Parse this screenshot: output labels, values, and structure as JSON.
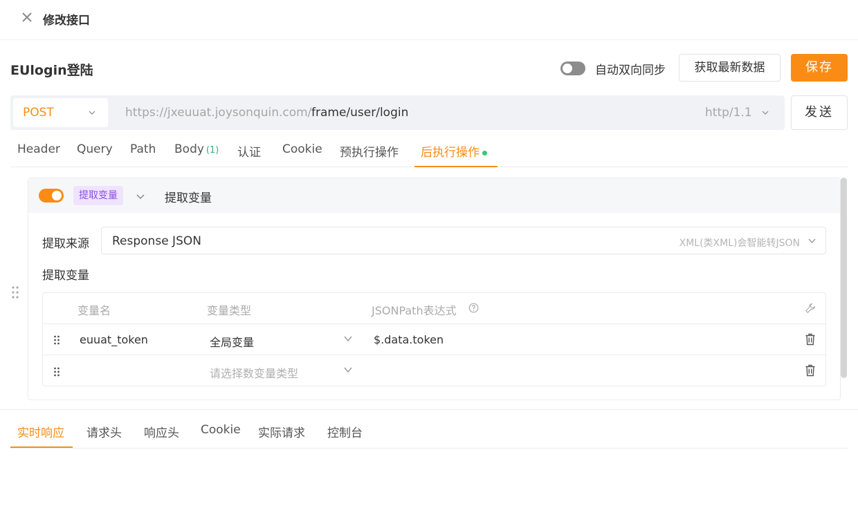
{
  "dialog": {
    "title": "修改接口"
  },
  "header": {
    "api_name": "EUlogin登陆",
    "sync_label": "自动双向同步",
    "fetch_label": "获取最新数据",
    "save_label": "保存"
  },
  "request": {
    "method": "POST",
    "base_url": "https://jxeuuat.joysonquin.com/",
    "path": "frame/user/login",
    "http_version": "http/1.1",
    "send_label": "发送"
  },
  "request_tabs": {
    "header": "Header",
    "query": "Query",
    "path": "Path",
    "body": "Body",
    "body_count": "(1)",
    "auth": "认证",
    "cookie": "Cookie",
    "pre_ops": "预执行操作",
    "post_ops": "后执行操作"
  },
  "post_op": {
    "enabled": true,
    "badge": "提取变量",
    "name": "提取变量",
    "source_label": "提取来源",
    "source_value": "Response JSON",
    "source_hint": "XML(类XML)会智能转JSON",
    "vars_label": "提取变量",
    "columns": {
      "name": "变量名",
      "type": "变量类型",
      "expr": "JSONPath表达式"
    },
    "rows": [
      {
        "name": "euuat_token",
        "type": "全局变量",
        "expr": "$.data.token"
      },
      {
        "type_placeholder": "请选择数变量类型"
      }
    ]
  },
  "response_tabs": {
    "realtime": "实时响应",
    "req_headers": "请求头",
    "resp_headers": "响应头",
    "cookie": "Cookie",
    "actual_request": "实际请求",
    "console": "控制台"
  },
  "colors": {
    "accent": "#fa8c16",
    "dot": "#2ecc71",
    "badge_bg": "#efe3ff",
    "badge_fg": "#8b4fe0"
  }
}
